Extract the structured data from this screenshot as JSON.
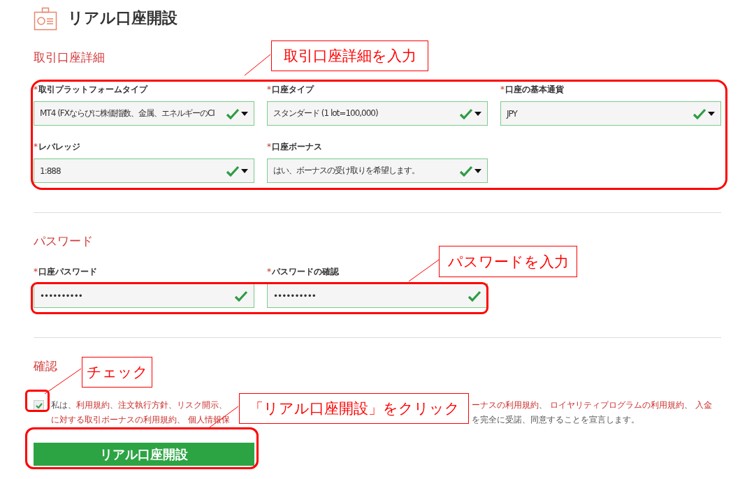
{
  "header": {
    "title": "リアル口座開設"
  },
  "sections": [
    {
      "title": "取引口座詳細",
      "rows": [
        [
          {
            "mark": "*",
            "label": "取引プラットフォームタイプ",
            "kind": "select",
            "value": "MT4 (FXならびに株価指数、金属、エネルギーのCI",
            "valid": true
          },
          {
            "mark": "*",
            "label": "口座タイプ",
            "kind": "select",
            "value": "スタンダード (1 lot=100,000)",
            "valid": true
          },
          {
            "mark": "*",
            "label": "口座の基本通貨",
            "kind": "select",
            "value": "JPY",
            "valid": true
          }
        ],
        [
          {
            "mark": "*",
            "label": "レバレッジ",
            "kind": "select",
            "value": "1:888",
            "valid": true
          },
          {
            "mark": "*",
            "label": "口座ボーナス",
            "kind": "select",
            "value": "はい、ボーナスの受け取りを希望します。",
            "valid": true
          }
        ]
      ]
    },
    {
      "title": "パスワード",
      "rows": [
        [
          {
            "mark": "*",
            "label": "口座パスワード",
            "kind": "password",
            "value": "••••••••••",
            "valid": true
          },
          {
            "mark": "*",
            "label": "パスワードの確認",
            "kind": "password",
            "value": "••••••••••",
            "valid": true
          }
        ]
      ]
    }
  ],
  "confirm": {
    "title": "確認",
    "checked": true,
    "lines": [
      {
        "left": [
          {
            "text": "私は、",
            "link": false
          },
          {
            "text": "利用規約",
            "link": true
          },
          {
            "text": "、",
            "link": false
          },
          {
            "text": "注文執行方針",
            "link": true
          },
          {
            "text": "、",
            "link": false
          },
          {
            "text": "リスク開示",
            "link": true
          },
          {
            "text": "、",
            "link": false
          }
        ],
        "right": [
          {
            "text": "ーナスの利用規約",
            "link": true
          },
          {
            "text": "、 ",
            "link": false
          },
          {
            "text": "ロイヤリティプログラムの利用規約",
            "link": true
          },
          {
            "text": "、 ",
            "link": false
          },
          {
            "text": "入金",
            "link": true
          }
        ]
      },
      {
        "left": [
          {
            "text": "に対する取引ボーナスの利用規約",
            "link": true
          },
          {
            "text": "、 ",
            "link": false
          },
          {
            "text": "個人情報保",
            "link": true
          }
        ],
        "right": [
          {
            "text": "を完全に受諾、同意することを宣言します。",
            "link": false
          }
        ]
      }
    ],
    "button": {
      "label": "リアル口座開設"
    }
  },
  "callouts": [
    {
      "text": "取引口座詳細を入力"
    },
    {
      "text": "パスワードを入力"
    },
    {
      "text": "チェック"
    },
    {
      "text": "「リアル口座開設」をクリック"
    }
  ]
}
